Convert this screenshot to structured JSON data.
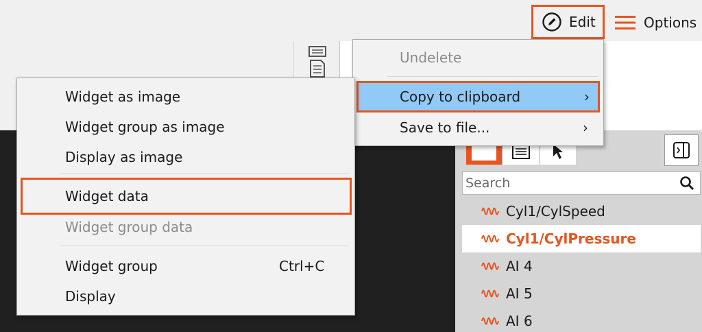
{
  "toolbar": {
    "edit_label": "Edit",
    "options_label": "Options"
  },
  "edit_menu": {
    "undelete": "Undelete",
    "copy_to_clipboard": "Copy to clipboard",
    "save_to_file": "Save to file...",
    "submenu_arrow": "›"
  },
  "copy_submenu": {
    "widget_as_image": "Widget as image",
    "widget_group_as_image": "Widget group as image",
    "display_as_image": "Display as image",
    "widget_data": "Widget data",
    "widget_group_data": "Widget group data",
    "widget_group": "Widget group",
    "widget_group_shortcut": "Ctrl+C",
    "display": "Display"
  },
  "right_panel": {
    "search_placeholder": "Search",
    "signals": [
      "Cyl1/CylSpeed",
      "Cyl1/CylPressure",
      "AI 4",
      "AI 5",
      "AI 6"
    ],
    "selected_signal": "Cyl1/CylPressure"
  },
  "colors": {
    "accent": "#e65520",
    "highlight": "#91c9f7",
    "dark_canvas": "#202020"
  },
  "icons": {
    "edit": "edit-pencil-circle-icon",
    "options": "hamburger-icon",
    "search": "search-icon",
    "signal": "waveform-icon",
    "side_panel": "panel-toggle-icon"
  }
}
